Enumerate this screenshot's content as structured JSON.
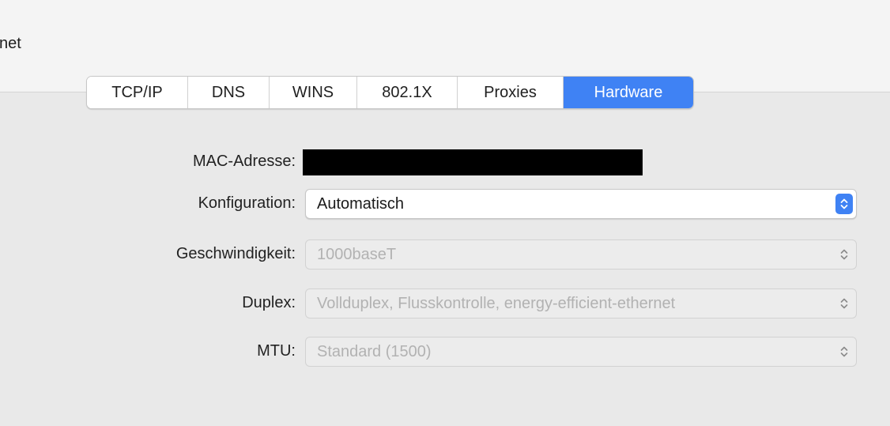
{
  "window": {
    "title": "net"
  },
  "tabs": [
    {
      "label": "TCP/IP",
      "selected": false
    },
    {
      "label": "DNS",
      "selected": false
    },
    {
      "label": "WINS",
      "selected": false
    },
    {
      "label": "802.1X",
      "selected": false
    },
    {
      "label": "Proxies",
      "selected": false
    },
    {
      "label": "Hardware",
      "selected": true
    }
  ],
  "hardware": {
    "mac_label": "MAC-Adresse:",
    "config_label": "Konfiguration:",
    "config_value": "Automatisch",
    "speed_label": "Geschwindigkeit:",
    "speed_value": "1000baseT",
    "duplex_label": "Duplex:",
    "duplex_value": "Vollduplex, Flusskontrolle, energy-efficient-ethernet",
    "mtu_label": "MTU:",
    "mtu_value": "Standard (1500)"
  },
  "icons": {
    "popup_arrows": "chevron-up-down-icon"
  },
  "colors": {
    "accent": "#3f82f4",
    "panel_background": "#e9e9e9",
    "disabled_text": "#b2b2b2",
    "redaction": "#000000"
  }
}
